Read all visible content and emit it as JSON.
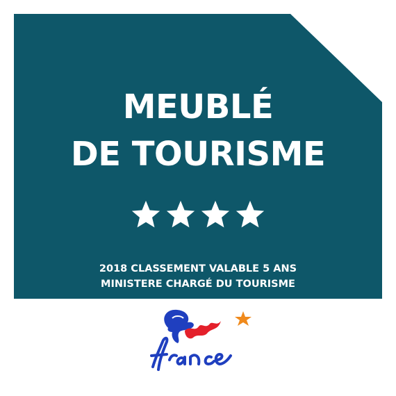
{
  "plaque": {
    "title_line1": "MEUBLÉ",
    "title_line2": "DE TOURISME",
    "stars": 4,
    "footer_line1": "2018  CLASSEMENT VALABLE 5 ANS",
    "footer_line2": "MINISTERE CHARGÉ DU TOURISME"
  },
  "logo": {
    "wordmark": "france",
    "icon": "marianne-france-logo"
  },
  "colors": {
    "plaque_bg": "#0e5769",
    "text": "#ffffff",
    "logo_blue": "#1f3fbf",
    "logo_red": "#e4202b",
    "logo_orange": "#f08a1c"
  }
}
